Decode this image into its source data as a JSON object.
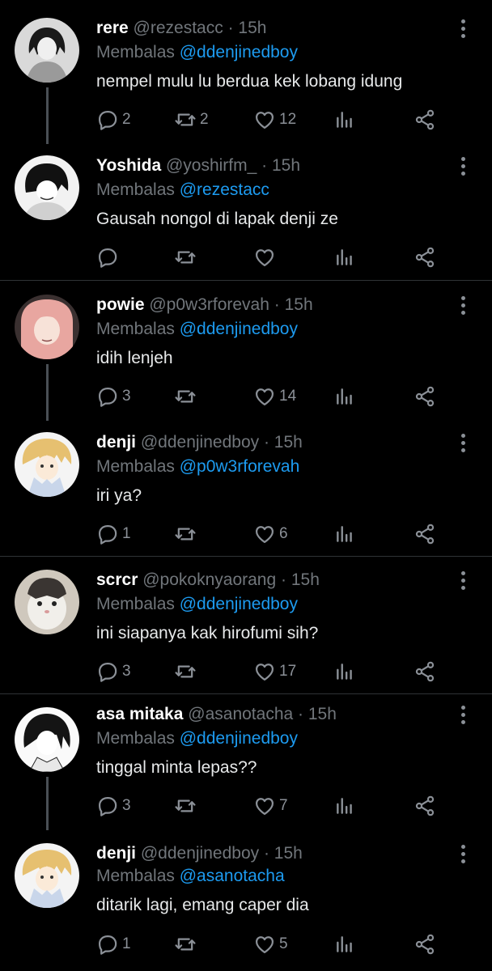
{
  "reply_prefix": "Membalas",
  "colors": {
    "background": "#000000",
    "name": "#ffffff",
    "muted": "#71767b",
    "link": "#1d9bf0",
    "thread_line": "#4a4f55",
    "separator": "#2f3336"
  },
  "icons": [
    "reply-icon",
    "retweet-icon",
    "like-icon",
    "analytics-icon",
    "share-icon",
    "more-options-icon"
  ],
  "tweets": [
    {
      "name": "rere",
      "handle": "@rezestacc",
      "time": "15h",
      "reply_to": "@ddenjinedboy",
      "text": "nempel mulu lu berdua kek lobang idung",
      "replies": "2",
      "retweets": "2",
      "likes": "12"
    },
    {
      "name": "Yoshida",
      "handle": "@yoshirfm_",
      "time": "15h",
      "reply_to": "@rezestacc",
      "text": "Gausah nongol di lapak denji ze",
      "replies": "",
      "retweets": "",
      "likes": ""
    },
    {
      "name": "powie",
      "handle": "@p0w3rforevah",
      "time": "15h",
      "reply_to": "@ddenjinedboy",
      "text": "idih lenjeh",
      "replies": "3",
      "retweets": "",
      "likes": "14"
    },
    {
      "name": "denji",
      "handle": "@ddenjinedboy",
      "time": "15h",
      "reply_to": "@p0w3rforevah",
      "text": "iri ya?",
      "replies": "1",
      "retweets": "",
      "likes": "6"
    },
    {
      "name": "scrcr",
      "handle": "@pokoknyaorang",
      "time": "15h",
      "reply_to": "@ddenjinedboy",
      "text": "ini siapanya kak hirofumi sih?",
      "replies": "3",
      "retweets": "",
      "likes": "17"
    },
    {
      "name": "asa mitaka",
      "handle": "@asanotacha",
      "time": "15h",
      "reply_to": "@ddenjinedboy",
      "text": "tinggal minta lepas??",
      "replies": "3",
      "retweets": "",
      "likes": "7"
    },
    {
      "name": "denji",
      "handle": "@ddenjinedboy",
      "time": "15h",
      "reply_to": "@asanotacha",
      "text": "ditarik lagi, emang caper dia",
      "replies": "1",
      "retweets": "",
      "likes": "5"
    }
  ]
}
